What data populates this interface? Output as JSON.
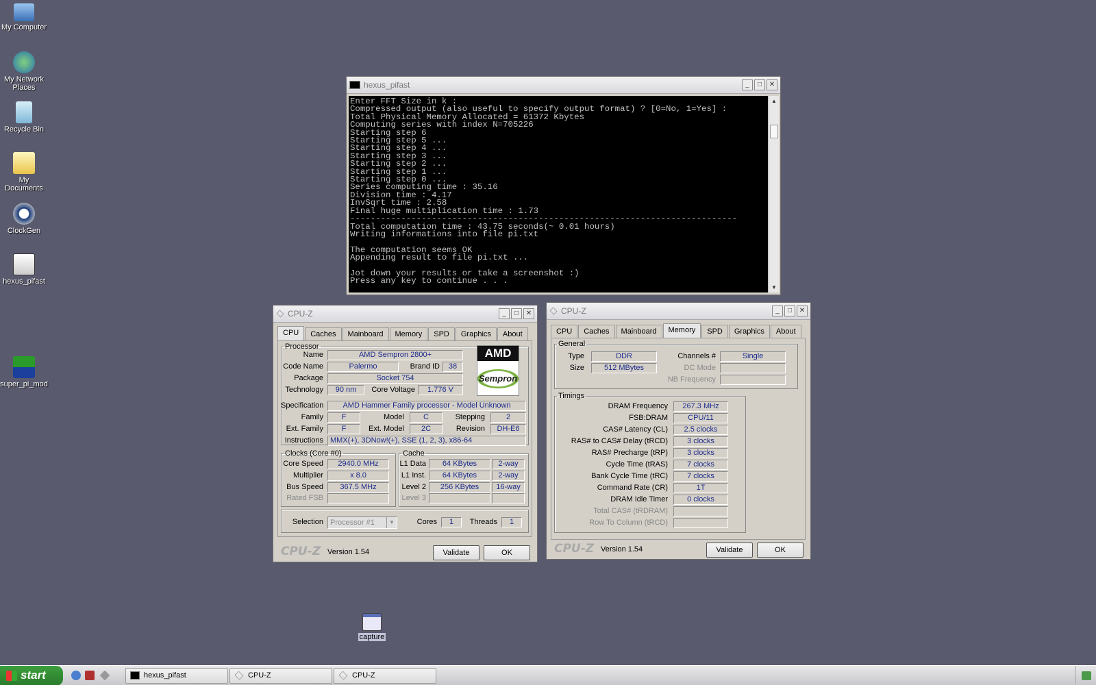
{
  "desktop": {
    "icons": [
      {
        "label": "My Computer"
      },
      {
        "label": "My Network Places"
      },
      {
        "label": "Recycle Bin"
      },
      {
        "label": "My Documents"
      },
      {
        "label": "ClockGen"
      },
      {
        "label": "hexus_pifast"
      },
      {
        "label": "super_pi_mod"
      },
      {
        "label": "capture"
      }
    ]
  },
  "console": {
    "title": "hexus_pifast",
    "lines": [
      "Enter FFT Size in k :",
      "Compressed output (also useful to specify output format) ? [0=No, 1=Yes] :",
      "Total Physical Memory Allocated = 61372 Kbytes",
      "Computing series with index N=705226",
      "Starting step 6",
      "Starting step 5 ...",
      "Starting step 4 ...",
      "Starting step 3 ...",
      "Starting step 2 ...",
      "Starting step 1 ...",
      "Starting step 0 ...",
      "Series computing time : 35.16",
      "Division time : 4.17",
      "InvSqrt time : 2.58",
      "Final huge multiplication time : 1.73",
      "----------------------------------------------------------------------------",
      "Total computation time : 43.75 seconds(~ 0.01 hours)",
      "Writing informations into file pi.txt",
      "",
      "The computation seems OK",
      "Appending result to file pi.txt ...",
      "",
      "Jot down your results or take a screenshot :)",
      "Press any key to continue . . ."
    ]
  },
  "cpuz1": {
    "title": "CPU-Z",
    "tabs": [
      "CPU",
      "Caches",
      "Mainboard",
      "Memory",
      "SPD",
      "Graphics",
      "About"
    ],
    "active_tab": "CPU",
    "processor_legend": "Processor",
    "name_label": "Name",
    "name": "AMD Sempron 2800+",
    "codename_label": "Code Name",
    "codename": "Palermo",
    "brandid_label": "Brand ID",
    "brandid": "38",
    "package_label": "Package",
    "package": "Socket 754",
    "technology_label": "Technology",
    "technology": "90 nm",
    "corevoltage_label": "Core Voltage",
    "corevoltage": "1.776 V",
    "logo_top": "AMD",
    "logo_bottom": "Sempron",
    "spec_label": "Specification",
    "spec": "AMD Hammer Family processor - Model Unknown",
    "family_label": "Family",
    "family": "F",
    "model_label": "Model",
    "model": "C",
    "stepping_label": "Stepping",
    "stepping": "2",
    "extfamily_label": "Ext. Family",
    "extfamily": "F",
    "extmodel_label": "Ext. Model",
    "extmodel": "2C",
    "revision_label": "Revision",
    "revision": "DH-E6",
    "instructions_label": "Instructions",
    "instructions": "MMX(+), 3DNow!(+), SSE (1, 2, 3), x86-64",
    "clocks_legend": "Clocks (Core #0)",
    "corespeed_label": "Core Speed",
    "corespeed": "2940.0 MHz",
    "multiplier_label": "Multiplier",
    "multiplier": "x 8.0",
    "busspeed_label": "Bus Speed",
    "busspeed": "367.5 MHz",
    "ratedfsb_label": "Rated FSB",
    "ratedfsb": "",
    "cache_legend": "Cache",
    "l1data_label": "L1 Data",
    "l1data": "64 KBytes",
    "l1data_way": "2-way",
    "l1inst_label": "L1 Inst.",
    "l1inst": "64 KBytes",
    "l1inst_way": "2-way",
    "level2_label": "Level 2",
    "level2": "256 KBytes",
    "level2_way": "16-way",
    "level3_label": "Level 3",
    "level3": "",
    "level3_way": "",
    "selection_label": "Selection",
    "selection": "Processor #1",
    "cores_label": "Cores",
    "cores": "1",
    "threads_label": "Threads",
    "threads": "1",
    "brand": "CPU-Z",
    "version": "Version 1.54",
    "validate": "Validate",
    "ok": "OK"
  },
  "cpuz2": {
    "title": "CPU-Z",
    "tabs": [
      "CPU",
      "Caches",
      "Mainboard",
      "Memory",
      "SPD",
      "Graphics",
      "About"
    ],
    "active_tab": "Memory",
    "general_legend": "General",
    "type_label": "Type",
    "type": "DDR",
    "size_label": "Size",
    "size": "512 MBytes",
    "channels_label": "Channels #",
    "channels": "Single",
    "dcmode_label": "DC Mode",
    "dcmode": "",
    "nbfreq_label": "NB Frequency",
    "nbfreq": "",
    "timings_legend": "Timings",
    "timings": [
      {
        "label": "DRAM Frequency",
        "value": "267.3 MHz"
      },
      {
        "label": "FSB:DRAM",
        "value": "CPU/11"
      },
      {
        "label": "CAS# Latency (CL)",
        "value": "2.5 clocks"
      },
      {
        "label": "RAS# to CAS# Delay (tRCD)",
        "value": "3 clocks"
      },
      {
        "label": "RAS# Precharge (tRP)",
        "value": "3 clocks"
      },
      {
        "label": "Cycle Time (tRAS)",
        "value": "7 clocks"
      },
      {
        "label": "Bank Cycle Time (tRC)",
        "value": "7 clocks"
      },
      {
        "label": "Command Rate (CR)",
        "value": "1T"
      },
      {
        "label": "DRAM Idle Timer",
        "value": "0 clocks"
      },
      {
        "label": "Total CAS# (tRDRAM)",
        "value": ""
      },
      {
        "label": "Row To Column (tRCD)",
        "value": ""
      }
    ],
    "brand": "CPU-Z",
    "version": "Version 1.54",
    "validate": "Validate",
    "ok": "OK"
  },
  "taskbar": {
    "start": "start",
    "tasks": [
      {
        "label": "hexus_pifast"
      },
      {
        "label": "CPU-Z"
      },
      {
        "label": "CPU-Z"
      }
    ]
  },
  "colors": {
    "desktop": "#5a5a6e",
    "value_text": "#1d2c8b",
    "start_green": "#3d9e3d"
  }
}
